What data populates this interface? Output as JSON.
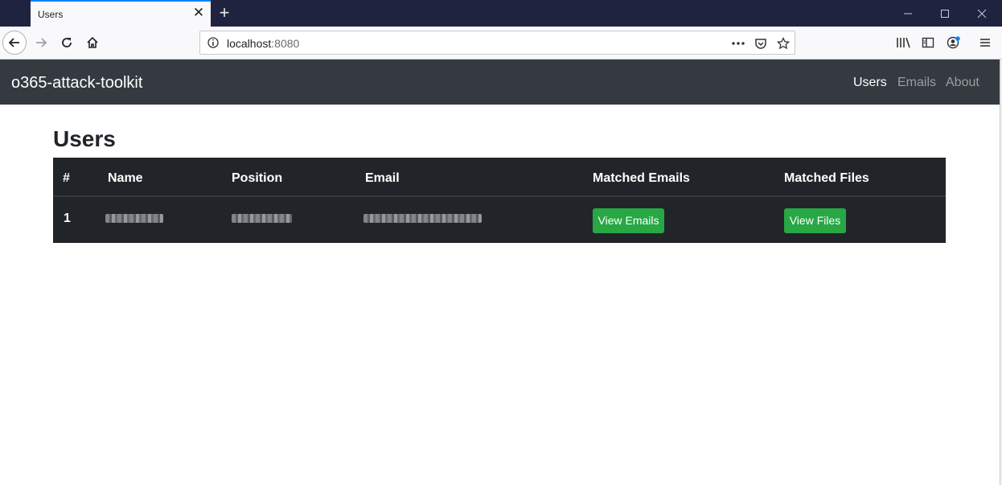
{
  "browser": {
    "tab_title": "Users",
    "url_host": "localhost",
    "url_port": ":8080"
  },
  "navbar": {
    "brand": "o365-attack-toolkit",
    "links": [
      "Users",
      "Emails",
      "About"
    ]
  },
  "page": {
    "title": "Users"
  },
  "table": {
    "headers": [
      "#",
      "Name",
      "Position",
      "Email",
      "Matched Emails",
      "Matched Files"
    ],
    "rows": [
      {
        "index": "1",
        "view_emails_label": "View Emails",
        "view_files_label": "View Files"
      }
    ]
  },
  "colors": {
    "navbar_bg": "#343a40",
    "table_bg": "#212529",
    "button_success": "#28a745",
    "tab_accent": "#0a84ff"
  }
}
